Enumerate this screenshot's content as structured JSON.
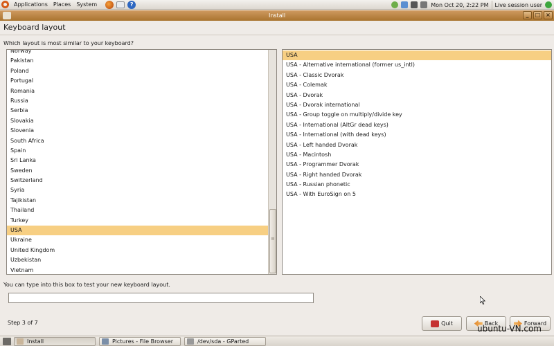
{
  "top_panel": {
    "menus": [
      "Applications",
      "Places",
      "System"
    ],
    "clock": "Mon Oct 20,  2:22 PM",
    "user": "Live session user"
  },
  "window": {
    "title": "Install",
    "controls": [
      "_",
      "□",
      "×"
    ]
  },
  "page": {
    "heading": "Keyboard layout",
    "question": "Which layout is most similar to your keyboard?",
    "hint": "You can type into this box to test your new keyboard layout.",
    "test_input_value": "",
    "step": "Step 3 of 7"
  },
  "countries": {
    "items": [
      "Norway",
      "Pakistan",
      "Poland",
      "Portugal",
      "Romania",
      "Russia",
      "Serbia",
      "Slovakia",
      "Slovenia",
      "South Africa",
      "Spain",
      "Sri Lanka",
      "Sweden",
      "Switzerland",
      "Syria",
      "Tajikistan",
      "Thailand",
      "Turkey",
      "USA",
      "Ukraine",
      "United Kingdom",
      "Uzbekistan",
      "Vietnam"
    ],
    "selected": "USA"
  },
  "variants": {
    "items": [
      "USA",
      "USA - Alternative international (former us_intl)",
      "USA - Classic Dvorak",
      "USA - Colemak",
      "USA - Dvorak",
      "USA - Dvorak international",
      "USA - Group toggle on multiply/divide key",
      "USA - International (AltGr dead keys)",
      "USA - International (with dead keys)",
      "USA - Left handed Dvorak",
      "USA - Macintosh",
      "USA - Programmer Dvorak",
      "USA - Right handed Dvorak",
      "USA - Russian phonetic",
      "USA - With EuroSign on 5"
    ],
    "selected": "USA"
  },
  "buttons": {
    "quit": "Quit",
    "back": "Back",
    "forward": "Forward"
  },
  "taskbar": {
    "tasks": [
      "Install",
      "Pictures - File Browser",
      "/dev/sda - GParted"
    ]
  },
  "watermark": "ubuntu-VN.com",
  "colors": {
    "title_bar": "#b8823f",
    "selection": "#f7cf83",
    "panel": "#e7e3dd"
  }
}
